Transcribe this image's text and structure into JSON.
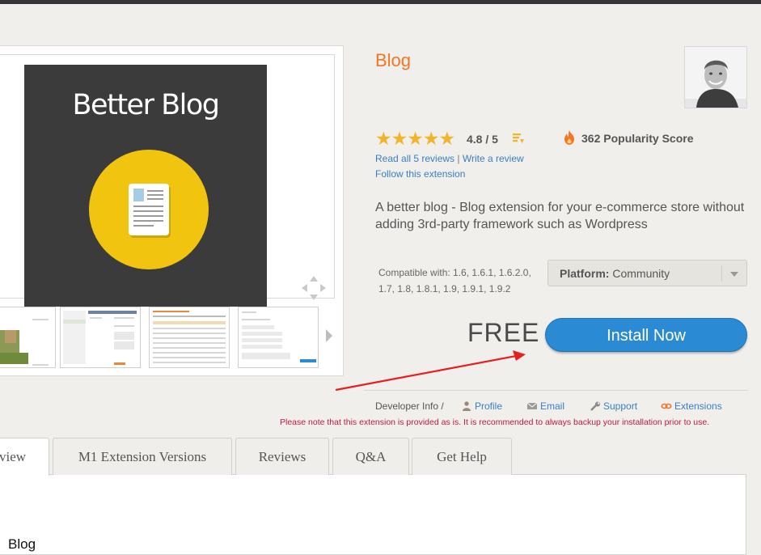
{
  "product": {
    "title": "Blog",
    "image_title": "Better Blog",
    "rating_stars": "★★★★★",
    "rating_text": "4.8 / 5",
    "popularity": "362 Popularity Score",
    "read_reviews": "Read all 5 reviews",
    "separator": "|",
    "write_review": "Write a review",
    "follow": "Follow this extension",
    "description": "A better blog - Blog extension for your e-commerce store without adding 3rd-party framework such as Wordpress",
    "compatible": "Compatible with: 1.6, 1.6.1, 1.6.2.0, 1.7, 1.8, 1.8.1, 1.9, 1.9.1, 1.9.2",
    "platform_label": "Platform:",
    "platform_value": "Community",
    "price": "FREE",
    "install_label": "Install Now"
  },
  "developer": {
    "label": "Developer Info /",
    "links": [
      "Profile",
      "Email",
      "Support",
      "Extensions"
    ]
  },
  "note": "Please note that this extension is provided as is. It is recommended to always backup your installation prior to use.",
  "tabs": [
    "view",
    "M1 Extension Versions",
    "Reviews",
    "Q&A",
    "Get Help"
  ],
  "content": {
    "heading": "Blog"
  },
  "colors": {
    "accent": "#f27624",
    "link": "#3a7fc1",
    "install": "#2b8ad4",
    "star": "#f3b42c",
    "note": "#c0183e"
  },
  "icons": [
    "zoom-icon",
    "rating-detail-icon",
    "flame-icon",
    "profile-icon",
    "email-icon",
    "support-icon",
    "extensions-icon",
    "gallery-next-icon"
  ]
}
